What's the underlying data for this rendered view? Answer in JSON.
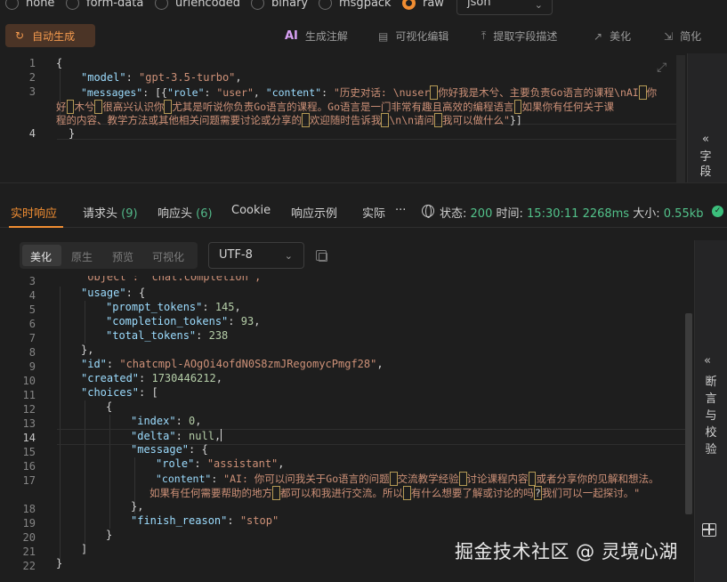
{
  "body_types": {
    "options": [
      "none",
      "form-data",
      "urlencoded",
      "binary",
      "msgpack",
      "raw"
    ],
    "selected": "raw"
  },
  "format_select": {
    "value": "json"
  },
  "request_toolbar": {
    "auto_generate": "自动生成",
    "ai_mark": "AI",
    "generate_comment": "生成注解",
    "visual_edit": "可视化编辑",
    "extract_fields": "提取字段描述",
    "beautify": "美化",
    "simplify": "简化"
  },
  "request_editor": {
    "line_numbers": [
      "1",
      "2",
      "3",
      "",
      "",
      "4"
    ],
    "lines": {
      "l1": "{",
      "l2_key": "\"model\"",
      "l2_colon": ": ",
      "l2_val": "\"gpt-3.5-turbo\"",
      "l2_comma": ",",
      "l3_key": "\"messages\"",
      "l3_mid": ": [{",
      "l3_k2": "\"role\"",
      "l3_c2": ": ",
      "l3_v2": "\"user\"",
      "l3_sep": ", ",
      "l3_k3": "\"content\"",
      "l3_c3": ": ",
      "l3_v3_a": "\"历史对话: \\nuser",
      "l3_v3_b": "你好我是木兮、主要负责Go语言的课程\\nAI",
      "l3_v3_c": "你",
      "l3_w2_a": "好",
      "l3_w2_b": "木兮",
      "l3_w2_c": "很高兴认识你",
      "l3_w2_d": "尤其是听说你负责Go语言的课程。Go语言是一门非常有趣且高效的编程语言",
      "l3_w2_e": "如果你有任何关于课",
      "l3_w3_a": "程的内容、教学方法或其他相关问题需要讨论或分享的",
      "l3_w3_b": "欢迎随时告诉我",
      "l3_w3_c": "\\n\\n请问",
      "l3_w3_d": "我可以做什么\"",
      "l3_w3_e": "}]",
      "l4": "}"
    }
  },
  "field_panel_top": {
    "chevron": "«",
    "label": "字段"
  },
  "response_tabs": {
    "realtime": "实时响应",
    "request_headers": "请求头",
    "request_headers_count": "(9)",
    "response_headers": "响应头",
    "response_headers_count": "(6)",
    "cookie": "Cookie",
    "example": "响应示例",
    "actual": "实际",
    "more": "···"
  },
  "status": {
    "status_label": "状态:",
    "status_code": "200",
    "time_label": "时间:",
    "time_value": "15:30:11",
    "duration": "2268ms",
    "size_label": "大小:",
    "size_value": "0.55kb"
  },
  "view_modes": {
    "beautify": "美化",
    "raw": "原生",
    "preview": "预览",
    "visualize": "可视化",
    "selected": "美化"
  },
  "encoding_select": {
    "value": "UTF-8"
  },
  "response_editor": {
    "line_numbers": [
      "3",
      "4",
      "5",
      "6",
      "7",
      "8",
      "9",
      "10",
      "11",
      "12",
      "13",
      "14",
      "15",
      "16",
      "17",
      "",
      "18",
      "19",
      "20",
      "21",
      "22"
    ],
    "top_partial": "\"object\": \"chat.completion\",",
    "usage_key": "\"usage\"",
    "prompt_tokens_key": "\"prompt_tokens\"",
    "prompt_tokens": "145",
    "completion_tokens_key": "\"completion_tokens\"",
    "completion_tokens": "93",
    "total_tokens_key": "\"total_tokens\"",
    "total_tokens": "238",
    "id_key": "\"id\"",
    "id_value": "\"chatcmpl-AOgOi4ofdN0S8zmJRegomycPmgf28\"",
    "created_key": "\"created\"",
    "created_value": "1730446212",
    "choices_key": "\"choices\"",
    "index_key": "\"index\"",
    "index_value": "0",
    "delta_key": "\"delta\"",
    "delta_value": "null",
    "message_key": "\"message\"",
    "role_key": "\"role\"",
    "role_value": "\"assistant\"",
    "content_key": "\"content\"",
    "content_a": "\"AI: 你可以问我关于Go语言的问题",
    "content_b": "交流教学经验",
    "content_c": "讨论课程内容",
    "content_d": "或者分享你的见解和想法。",
    "content_w2_a": "如果有任何需要帮助的地方",
    "content_w2_b": "都可以和我进行交流。所以",
    "content_w2_c": "有什么想要了解或讨论的吗",
    "content_w2_d": "我们可以一起探讨。\"",
    "finish_reason_key": "\"finish_reason\"",
    "finish_reason_value": "\"stop\""
  },
  "side_panel": {
    "chevron": "«",
    "label": "断言与校验"
  },
  "watermark": "掘金技术社区 @ 灵境心湖"
}
